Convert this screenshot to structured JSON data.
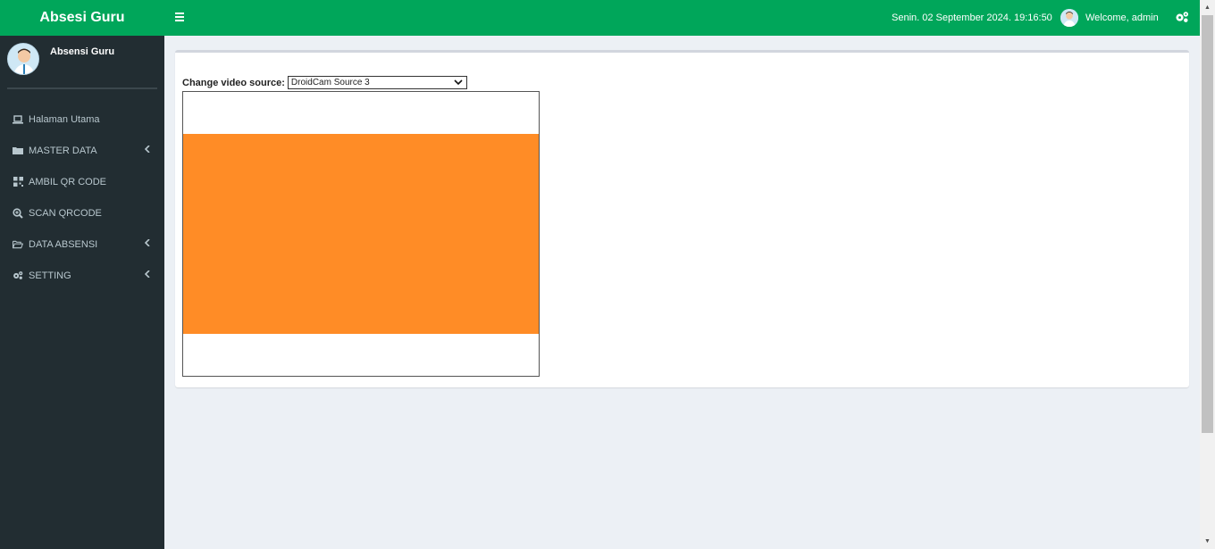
{
  "app": {
    "brand": "Absesi Guru"
  },
  "sidebar": {
    "user_name": "Absensi Guru",
    "items": [
      {
        "label": "Halaman Utama",
        "icon": "laptop-icon",
        "has_submenu": false
      },
      {
        "label": "MASTER DATA",
        "icon": "folder-icon",
        "has_submenu": true
      },
      {
        "label": "AMBIL QR CODE",
        "icon": "qrcode-icon",
        "has_submenu": false
      },
      {
        "label": "SCAN QRCODE",
        "icon": "search-plus-icon",
        "has_submenu": false
      },
      {
        "label": "DATA ABSENSI",
        "icon": "folder-open-icon",
        "has_submenu": true
      },
      {
        "label": "SETTING",
        "icon": "gears-icon",
        "has_submenu": true
      }
    ]
  },
  "header": {
    "datetime": "Senin. 02 September 2024. 19:16:50",
    "welcome": "Welcome, admin"
  },
  "main": {
    "source_label": "Change video source:",
    "source_value": "DroidCam Source 3"
  },
  "colors": {
    "brand_green": "#00a65a",
    "sidebar_bg": "#222d32",
    "video_feed": "#ff8c26"
  }
}
